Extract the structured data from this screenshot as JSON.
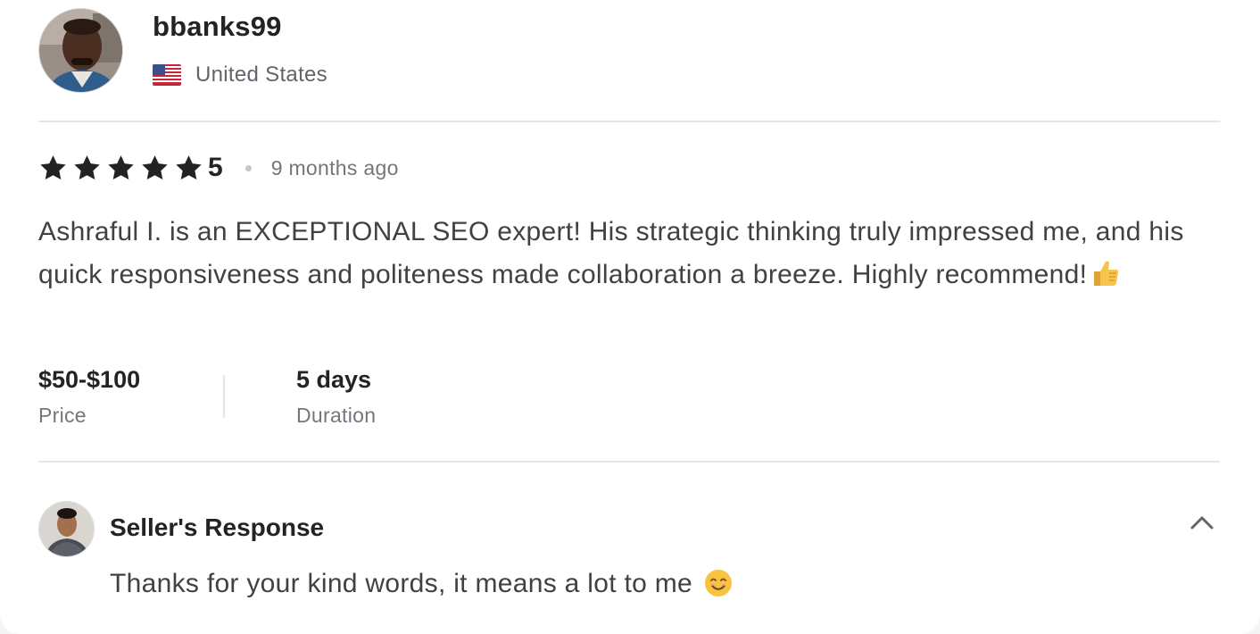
{
  "review": {
    "username": "bbanks99",
    "country": "United States",
    "country_flag_icon": "us-flag-icon",
    "rating": "5",
    "rating_value": 5,
    "time_ago": "9 months ago",
    "text": "Ashraful I. is an EXCEPTIONAL SEO expert! His strategic thinking truly impressed me, and his quick responsiveness and politeness made collaboration a breeze. Highly recommend!",
    "text_emoji": "thumbs-up-icon",
    "price_value": "$50-$100",
    "price_label": "Price",
    "duration_value": "5 days",
    "duration_label": "Duration"
  },
  "seller_response": {
    "title": "Seller's Response",
    "text": "Thanks for your kind words, it means a lot to me",
    "text_emoji": "smiling-face-icon",
    "collapse_icon": "chevron-up-icon"
  },
  "colors": {
    "star": "#222325",
    "divider": "#e4e5e7",
    "text": "#404145",
    "muted": "#74767e"
  }
}
